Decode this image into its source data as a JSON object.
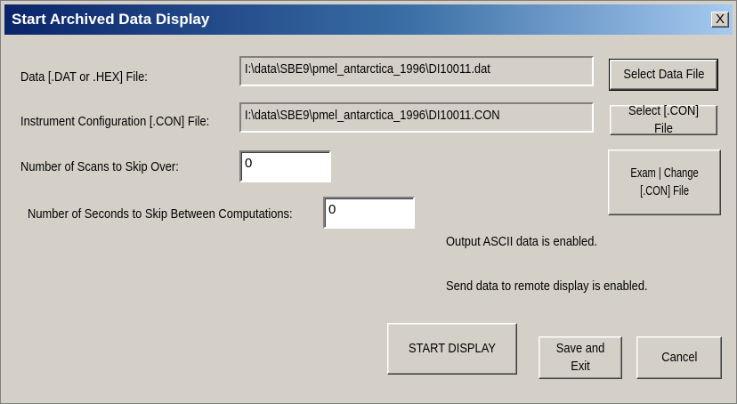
{
  "window": {
    "title": "Start Archived Data Display",
    "close_label": "X"
  },
  "form": {
    "data_file_label": "Data [.DAT or .HEX] File:",
    "data_file_value": "I:\\data\\SBE9\\pmel_antarctica_1996\\DI10011.dat",
    "config_file_label": "Instrument Configuration [.CON] File:",
    "config_file_value": "I:\\data\\SBE9\\pmel_antarctica_1996\\DI10011.CON",
    "scans_label": "Number of Scans to Skip Over:",
    "scans_value": "0",
    "seconds_label": "Number of Seconds to Skip Between Computations:",
    "seconds_value": "0"
  },
  "buttons": {
    "select_data_file": "Select Data File",
    "select_con_file": "Select [.CON] File",
    "exam_change_line1": "Exam | Change",
    "exam_change_line2": "[.CON] File",
    "start_display": "START DISPLAY",
    "save_and_exit": "Save and Exit",
    "cancel": "Cancel"
  },
  "status": {
    "ascii_output": "Output ASCII data is enabled.",
    "remote_display": "Send data to remote display is enabled."
  }
}
